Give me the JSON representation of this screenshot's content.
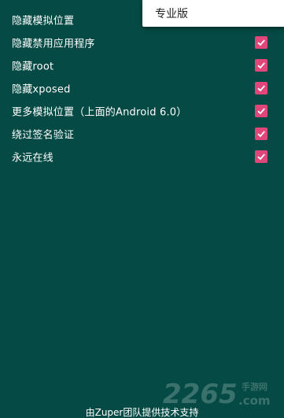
{
  "popup_menu": {
    "items": [
      {
        "label": "专业版"
      }
    ]
  },
  "settings": [
    {
      "label": "隐藏模拟位置",
      "checked": true
    },
    {
      "label": "隐藏禁用应用程序",
      "checked": true
    },
    {
      "label": "隐藏root",
      "checked": true
    },
    {
      "label": "隐藏xposed",
      "checked": true
    },
    {
      "label": "更多模拟位置（上面的Android 6.0）",
      "checked": true
    },
    {
      "label": "绕过签名验证",
      "checked": true
    },
    {
      "label": "永远在线",
      "checked": true
    }
  ],
  "footer": {
    "text": "由Zuper团队提供技术支持"
  },
  "watermark": {
    "logo_text": "2265",
    "suffix": ".com",
    "tagline": "手游网"
  },
  "colors": {
    "background": "#054a44",
    "checkbox": "#e0467a",
    "text": "#ffffff",
    "popup_bg": "#ffffff"
  }
}
